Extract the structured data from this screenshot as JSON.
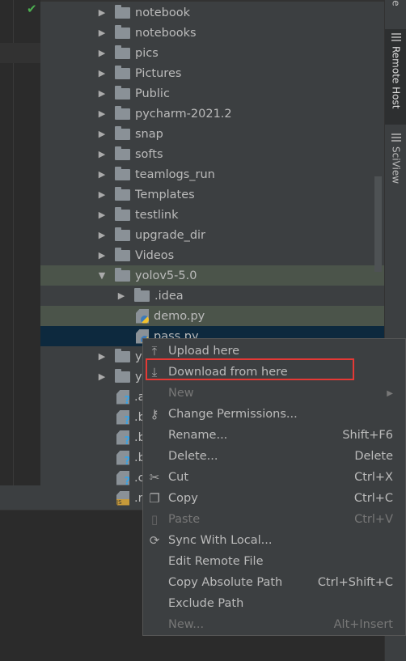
{
  "sidebar_tabs": [
    {
      "label": "se",
      "active": false
    },
    {
      "label": "Remote Host",
      "active": true
    },
    {
      "label": "SciView",
      "active": false
    }
  ],
  "tree": [
    {
      "label": "notebook",
      "type": "folder",
      "depth": 0
    },
    {
      "label": "notebooks",
      "type": "folder",
      "depth": 0
    },
    {
      "label": "pics",
      "type": "folder",
      "depth": 0
    },
    {
      "label": "Pictures",
      "type": "folder",
      "depth": 0
    },
    {
      "label": "Public",
      "type": "folder",
      "depth": 0
    },
    {
      "label": "pycharm-2021.2",
      "type": "folder",
      "depth": 0
    },
    {
      "label": "snap",
      "type": "folder",
      "depth": 0
    },
    {
      "label": "softs",
      "type": "folder",
      "depth": 0
    },
    {
      "label": "teamlogs_run",
      "type": "folder",
      "depth": 0
    },
    {
      "label": "Templates",
      "type": "folder",
      "depth": 0
    },
    {
      "label": "testlink",
      "type": "folder",
      "depth": 0
    },
    {
      "label": "upgrade_dir",
      "type": "folder",
      "depth": 0
    },
    {
      "label": "Videos",
      "type": "folder",
      "depth": 0
    },
    {
      "label": "yolov5-5.0",
      "type": "folder",
      "depth": 0,
      "expanded": true,
      "state": "selected-green"
    },
    {
      "label": ".idea",
      "type": "folder",
      "depth": 1
    },
    {
      "label": "demo.py",
      "type": "py",
      "depth": 1,
      "state": "selected-green"
    },
    {
      "label": "pass.py",
      "type": "py",
      "depth": 1,
      "state": "selected-blue"
    },
    {
      "label": "y",
      "type": "folder",
      "depth": 0
    },
    {
      "label": "y",
      "type": "folder",
      "depth": 0
    },
    {
      "label": ".a",
      "type": "unknown",
      "depth": 0
    },
    {
      "label": ".b",
      "type": "unknown",
      "depth": 0
    },
    {
      "label": ".b",
      "type": "unknown",
      "depth": 0
    },
    {
      "label": ".b",
      "type": "unknown",
      "depth": 0
    },
    {
      "label": ".c",
      "type": "unknown",
      "depth": 0
    },
    {
      "label": ".r",
      "type": "js",
      "depth": 0
    }
  ],
  "context_menu": [
    {
      "label": "Upload here",
      "mnemonic": "U",
      "icon": "upload-icon",
      "shortcut": "",
      "disabled": false
    },
    {
      "label": "Download from here",
      "mnemonic": "D",
      "icon": "download-icon",
      "shortcut": "",
      "disabled": false,
      "highlighted": true
    },
    {
      "label": "New",
      "mnemonic": "N",
      "icon": "",
      "shortcut": "",
      "disabled": true,
      "submenu": true
    },
    {
      "label": "Change Permissions...",
      "mnemonic": "P",
      "icon": "key-icon",
      "shortcut": "",
      "disabled": false
    },
    {
      "label": "Rename...",
      "mnemonic": "R",
      "icon": "",
      "shortcut": "Shift+F6",
      "disabled": false
    },
    {
      "label": "Delete...",
      "mnemonic": "D",
      "icon": "",
      "shortcut": "Delete",
      "disabled": false
    },
    {
      "label": "Cut",
      "mnemonic": "t",
      "icon": "scissors-icon",
      "shortcut": "Ctrl+X",
      "disabled": false
    },
    {
      "label": "Copy",
      "mnemonic": "C",
      "icon": "copy-icon",
      "shortcut": "Ctrl+C",
      "disabled": false
    },
    {
      "label": "Paste",
      "mnemonic": "P",
      "icon": "clipboard-icon",
      "shortcut": "Ctrl+V",
      "disabled": true
    },
    {
      "label": "Sync With Local...",
      "mnemonic": "S",
      "icon": "sync-icon",
      "shortcut": "",
      "disabled": false
    },
    {
      "label": "Edit Remote File",
      "mnemonic": "m",
      "icon": "",
      "shortcut": "",
      "disabled": false
    },
    {
      "label": "Copy Absolute Path",
      "mnemonic": "o",
      "icon": "",
      "shortcut": "Ctrl+Shift+C",
      "disabled": false
    },
    {
      "label": "Exclude Path",
      "mnemonic": "l",
      "icon": "",
      "shortcut": "",
      "disabled": false
    },
    {
      "label": "New...",
      "mnemonic": "",
      "icon": "",
      "shortcut": "Alt+Insert",
      "disabled": true
    }
  ],
  "colors": {
    "highlight_box": "#e53935",
    "selection_green": "#4b544a",
    "selection_blue": "#0d293e",
    "panel": "#3c3f41"
  }
}
